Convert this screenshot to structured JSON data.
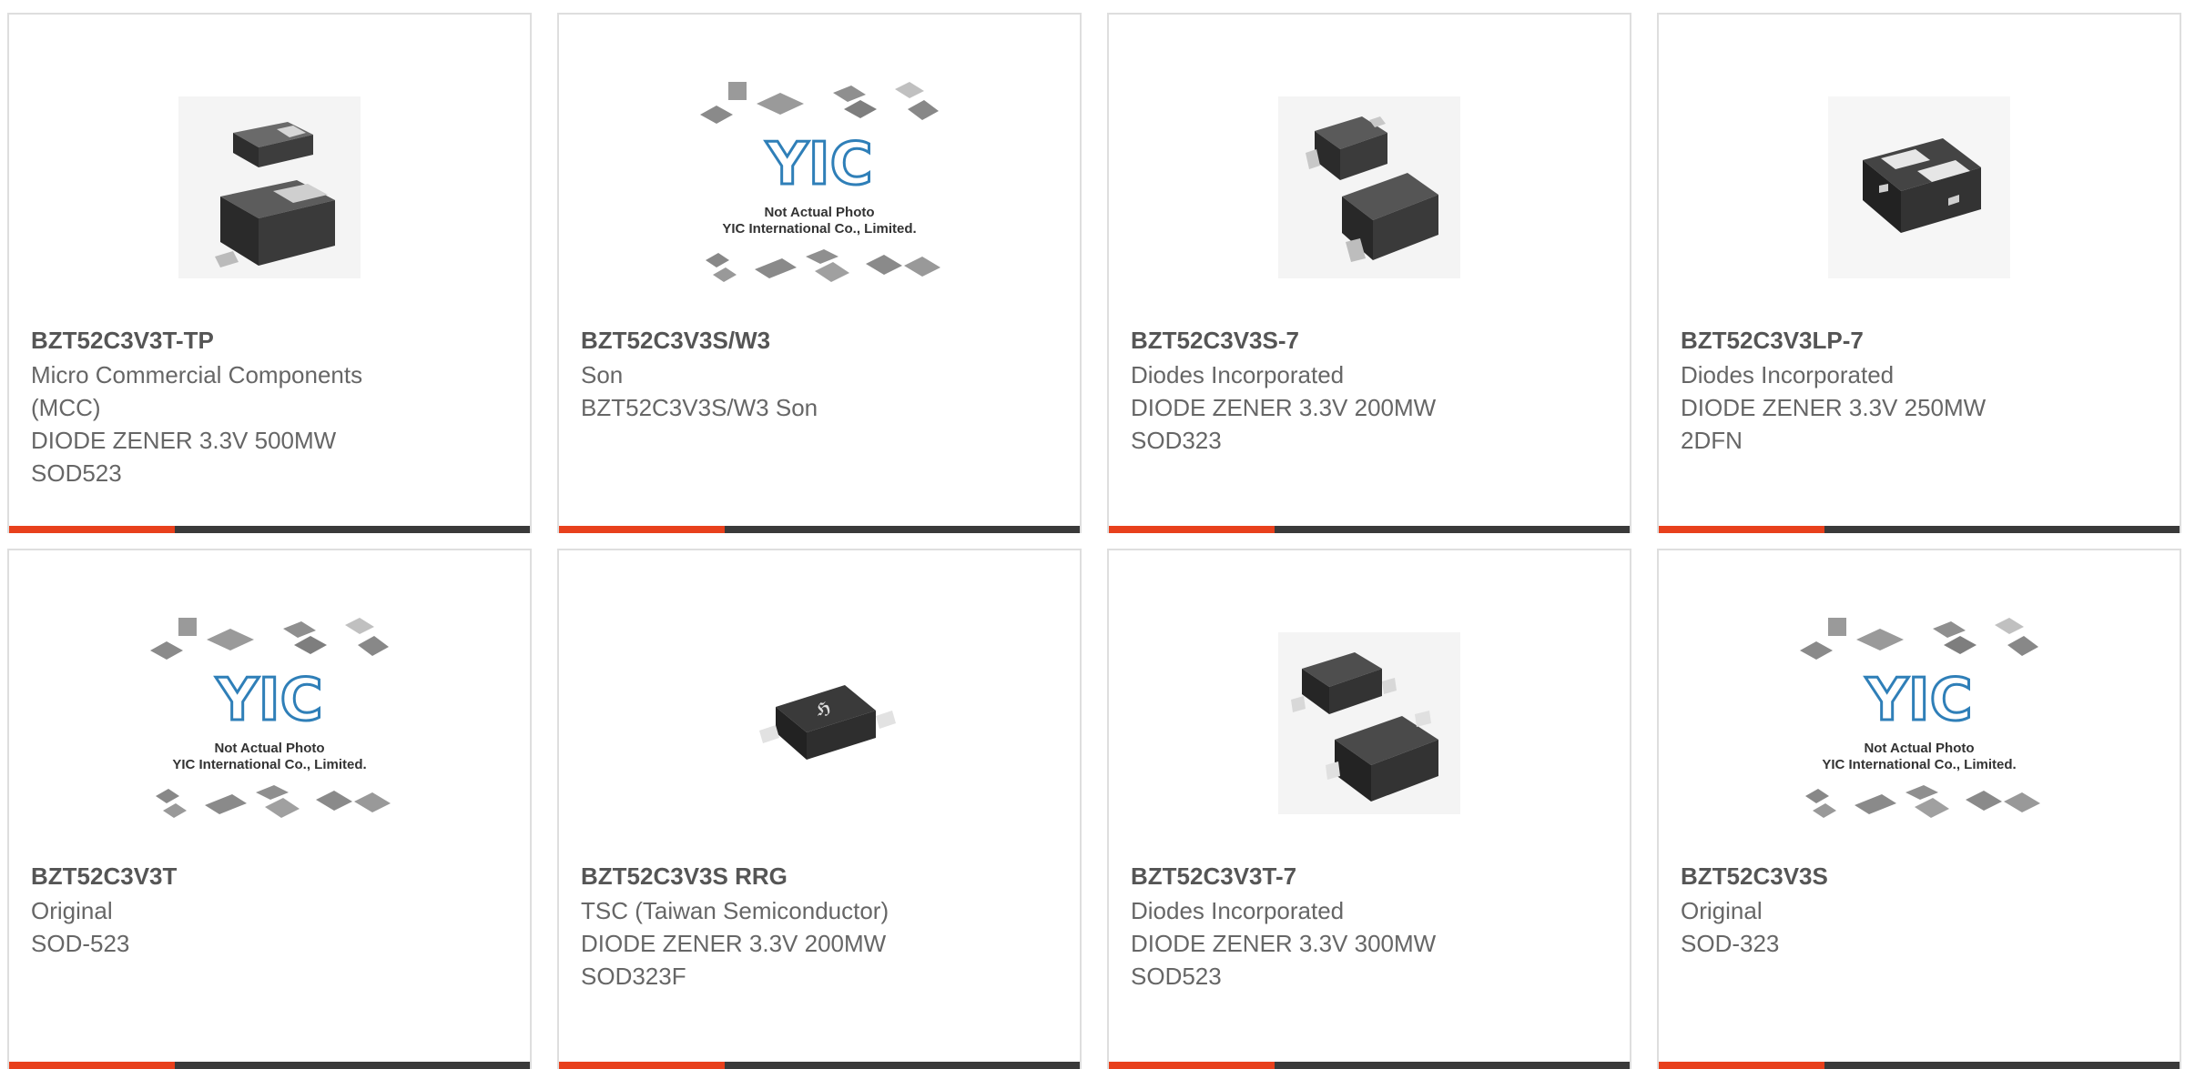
{
  "colors": {
    "accent": "#e8401c",
    "bar": "#3a3a3a",
    "border": "#dedede",
    "part_text": "#555555",
    "body_text": "#666666"
  },
  "cards": [
    {
      "part_number": "BZT52C3V3T-TP",
      "lines": [
        "Micro Commercial Components",
        "(MCC)",
        "DIODE ZENER 3.3V 500MW",
        "SOD523"
      ],
      "image": "sod523-package-photo"
    },
    {
      "part_number": "BZT52C3V3S/W3",
      "lines": [
        "Son",
        "BZT52C3V3S/W3 Son",
        "",
        ""
      ],
      "image": "yic-placeholder-photo",
      "placeholder": {
        "brand": "YIC",
        "line1": "Not Actual Photo",
        "line2": "YIC International Co., Limited."
      }
    },
    {
      "part_number": "BZT52C3V3S-7",
      "lines": [
        "Diodes Incorporated",
        "DIODE ZENER 3.3V 200MW",
        "SOD323",
        ""
      ],
      "image": "sod323-package-photo"
    },
    {
      "part_number": "BZT52C3V3LP-7",
      "lines": [
        "Diodes Incorporated",
        "DIODE ZENER 3.3V 250MW",
        "2DFN",
        ""
      ],
      "image": "dfn-package-photo"
    },
    {
      "part_number": "BZT52C3V3T",
      "lines": [
        "Original",
        "SOD-523",
        "",
        ""
      ],
      "image": "yic-placeholder-photo",
      "placeholder": {
        "brand": "YIC",
        "line1": "Not Actual Photo",
        "line2": "YIC International Co., Limited."
      }
    },
    {
      "part_number": "BZT52C3V3S RRG",
      "lines": [
        "TSC (Taiwan Semiconductor)",
        "DIODE ZENER 3.3V 200MW",
        "SOD323F",
        ""
      ],
      "image": "sod323f-package-photo"
    },
    {
      "part_number": "BZT52C3V3T-7",
      "lines": [
        "Diodes Incorporated",
        "DIODE ZENER 3.3V 300MW",
        "SOD523",
        ""
      ],
      "image": "sod523-package-photo"
    },
    {
      "part_number": "BZT52C3V3S",
      "lines": [
        "Original",
        "SOD-323",
        "",
        ""
      ],
      "image": "yic-placeholder-photo",
      "placeholder": {
        "brand": "YIC",
        "line1": "Not Actual Photo",
        "line2": "YIC International Co., Limited."
      }
    }
  ]
}
